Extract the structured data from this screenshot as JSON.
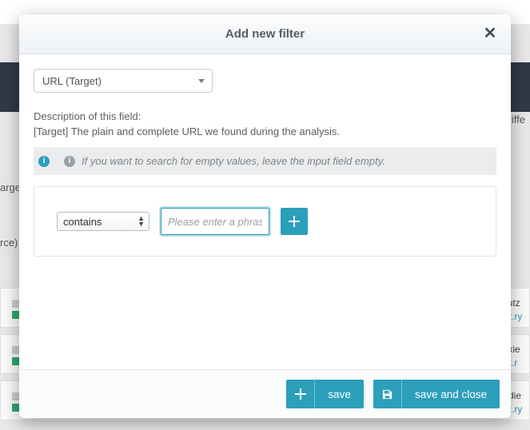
{
  "modal": {
    "title": "Add new filter",
    "field_selector": {
      "selected": "URL (Target)"
    },
    "description": {
      "heading": "Description of this field:",
      "text": "[Target] The plain and complete URL we found during the analysis."
    },
    "hint": "If you want to search for empty values, leave the input field empty.",
    "condition": {
      "operator": "contains",
      "placeholder": "Please enter a phrase",
      "value": ""
    },
    "buttons": {
      "save": "save",
      "save_close": "save and close"
    }
  },
  "background": {
    "fragments": {
      "diff": "Diffe",
      "arget": "arget",
      "rce": "rce)",
      "row1a": "Nutz",
      "row1b": "ert.ry",
      "row2a": "lexie",
      "row2b": "ort.r",
      "row3a": "n die",
      "row3b": "ert.ry"
    }
  },
  "colors": {
    "accent": "#2c9fbb"
  }
}
